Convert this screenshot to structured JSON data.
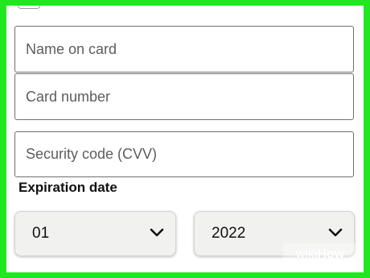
{
  "form": {
    "name_on_card": {
      "placeholder": "Name on card",
      "value": ""
    },
    "card_number": {
      "placeholder": "Card number",
      "value": ""
    },
    "security_code": {
      "placeholder": "Security code (CVV)",
      "value": ""
    },
    "expiration_label": "Expiration date",
    "expiration_month": {
      "selected": "01",
      "icon": "chevron-down-icon"
    },
    "expiration_year": {
      "selected": "2022",
      "icon": "chevron-down-icon"
    }
  },
  "watermark": {
    "prefix": "wiki",
    "suffix": "How"
  },
  "colors": {
    "frame": "#20e820",
    "field_border": "#6f6f6f",
    "select_bg": "#f1f1f0"
  }
}
